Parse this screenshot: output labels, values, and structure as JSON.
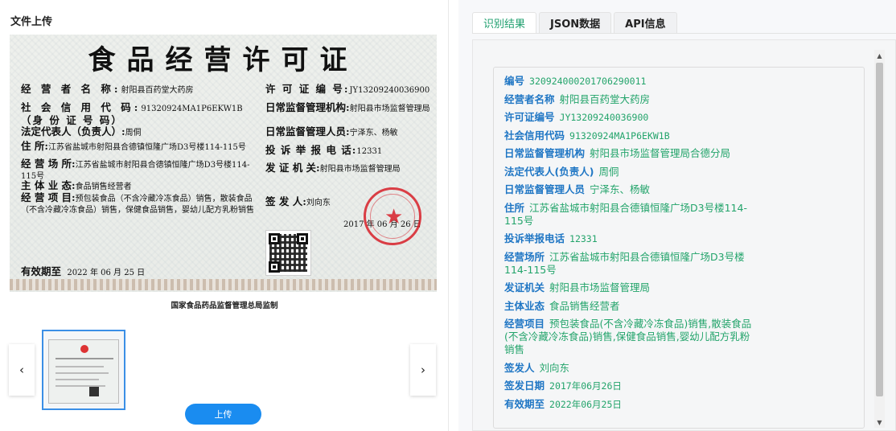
{
  "left": {
    "title": "文件上传",
    "upload_label": "上传",
    "prev_icon": "chevron-left-icon",
    "next_icon": "chevron-right-icon"
  },
  "certificate": {
    "title": "食品经营许可证",
    "fields": [
      {
        "k": "经 营 者 名 称:",
        "v": "射阳县百药堂大药房"
      },
      {
        "k": "社 会 信 用 代 码:",
        "v": "91320924MA1P6EKW1B"
      },
      {
        "k": "（身 份 证 号 码）",
        "v": ""
      },
      {
        "k": "法定代表人（负责人）:",
        "v": "周侗"
      },
      {
        "k": "住            所:",
        "v": "江苏省盐城市射阳县合德镇恒隆广场D3号楼114-115号"
      },
      {
        "k": "经    营    场    所:",
        "v": "江苏省盐城市射阳县合德镇恒隆广场D3号楼114-115号"
      },
      {
        "k": "主    体    业    态:",
        "v": "食品销售经营者"
      },
      {
        "k": "经    营    项    目:",
        "v": "预包装食品（不含冷藏冷冻食品）销售，散装食品（不含冷藏冷冻食品）销售，保健食品销售，婴幼儿配方乳粉销售"
      },
      {
        "k": "许 可 证 编 号:",
        "v": "JY13209240036900"
      },
      {
        "k": "日常监督管理机构:",
        "v": "射阳县市场监督管理局"
      },
      {
        "k": "日常监督管理人员:",
        "v": "宁泽东、杨敏"
      },
      {
        "k": "投 诉 举 报 电 话:",
        "v": "12331"
      },
      {
        "k": "发    证    机    关:",
        "v": "射阳县市场监督管理局"
      },
      {
        "k": "签        发        人:",
        "v": "刘向东"
      },
      {
        "k": "",
        "v": "2017 年 06 月 26 日"
      },
      {
        "k": "有效期至",
        "v": "2022 年 06 月 25 日"
      }
    ],
    "footer": "国家食品药品监督管理总局监制"
  },
  "right": {
    "tabs": [
      "识别结果",
      "JSON数据",
      "API信息"
    ],
    "active_tab": 0,
    "results": [
      {
        "k": "编号",
        "v": "320924000201706290011"
      },
      {
        "k": "经营者名称",
        "v": "射阳县百药堂大药房"
      },
      {
        "k": "许可证编号",
        "v": "JY13209240036900"
      },
      {
        "k": "社会信用代码",
        "v": "91320924MA1P6EKW1B"
      },
      {
        "k": "日常监督管理机构",
        "v": "射阳县市场监督管理局合德分局"
      },
      {
        "k": "法定代表人(负责人)",
        "v": "周侗"
      },
      {
        "k": "日常监督管理人员",
        "v": "宁泽东、杨敏"
      },
      {
        "k": "住所",
        "v": "江苏省盐城市射阳县合德镇恒隆广场D3号楼114-115号"
      },
      {
        "k": "投诉举报电话",
        "v": "12331"
      },
      {
        "k": "经营场所",
        "v": "江苏省盐城市射阳县合德镇恒隆广场D3号楼114-115号"
      },
      {
        "k": "发证机关",
        "v": "射阳县市场监督管理局"
      },
      {
        "k": "主体业态",
        "v": "食品销售经营者"
      },
      {
        "k": "经营项目",
        "v": "预包装食品(不含冷藏冷冻食品)销售,散装食品(不含冷藏冷冻食品)销售,保健食品销售,婴幼儿配方乳粉销售"
      },
      {
        "k": "签发人",
        "v": "刘向东"
      },
      {
        "k": "签发日期",
        "v": "2017年06月26日"
      },
      {
        "k": "有效期至",
        "v": "2022年06月25日"
      }
    ]
  },
  "colors": {
    "accent": "#1a8cf0",
    "result_key": "#1f76c4",
    "result_value": "#23a46b",
    "stamp": "#d71e28"
  }
}
